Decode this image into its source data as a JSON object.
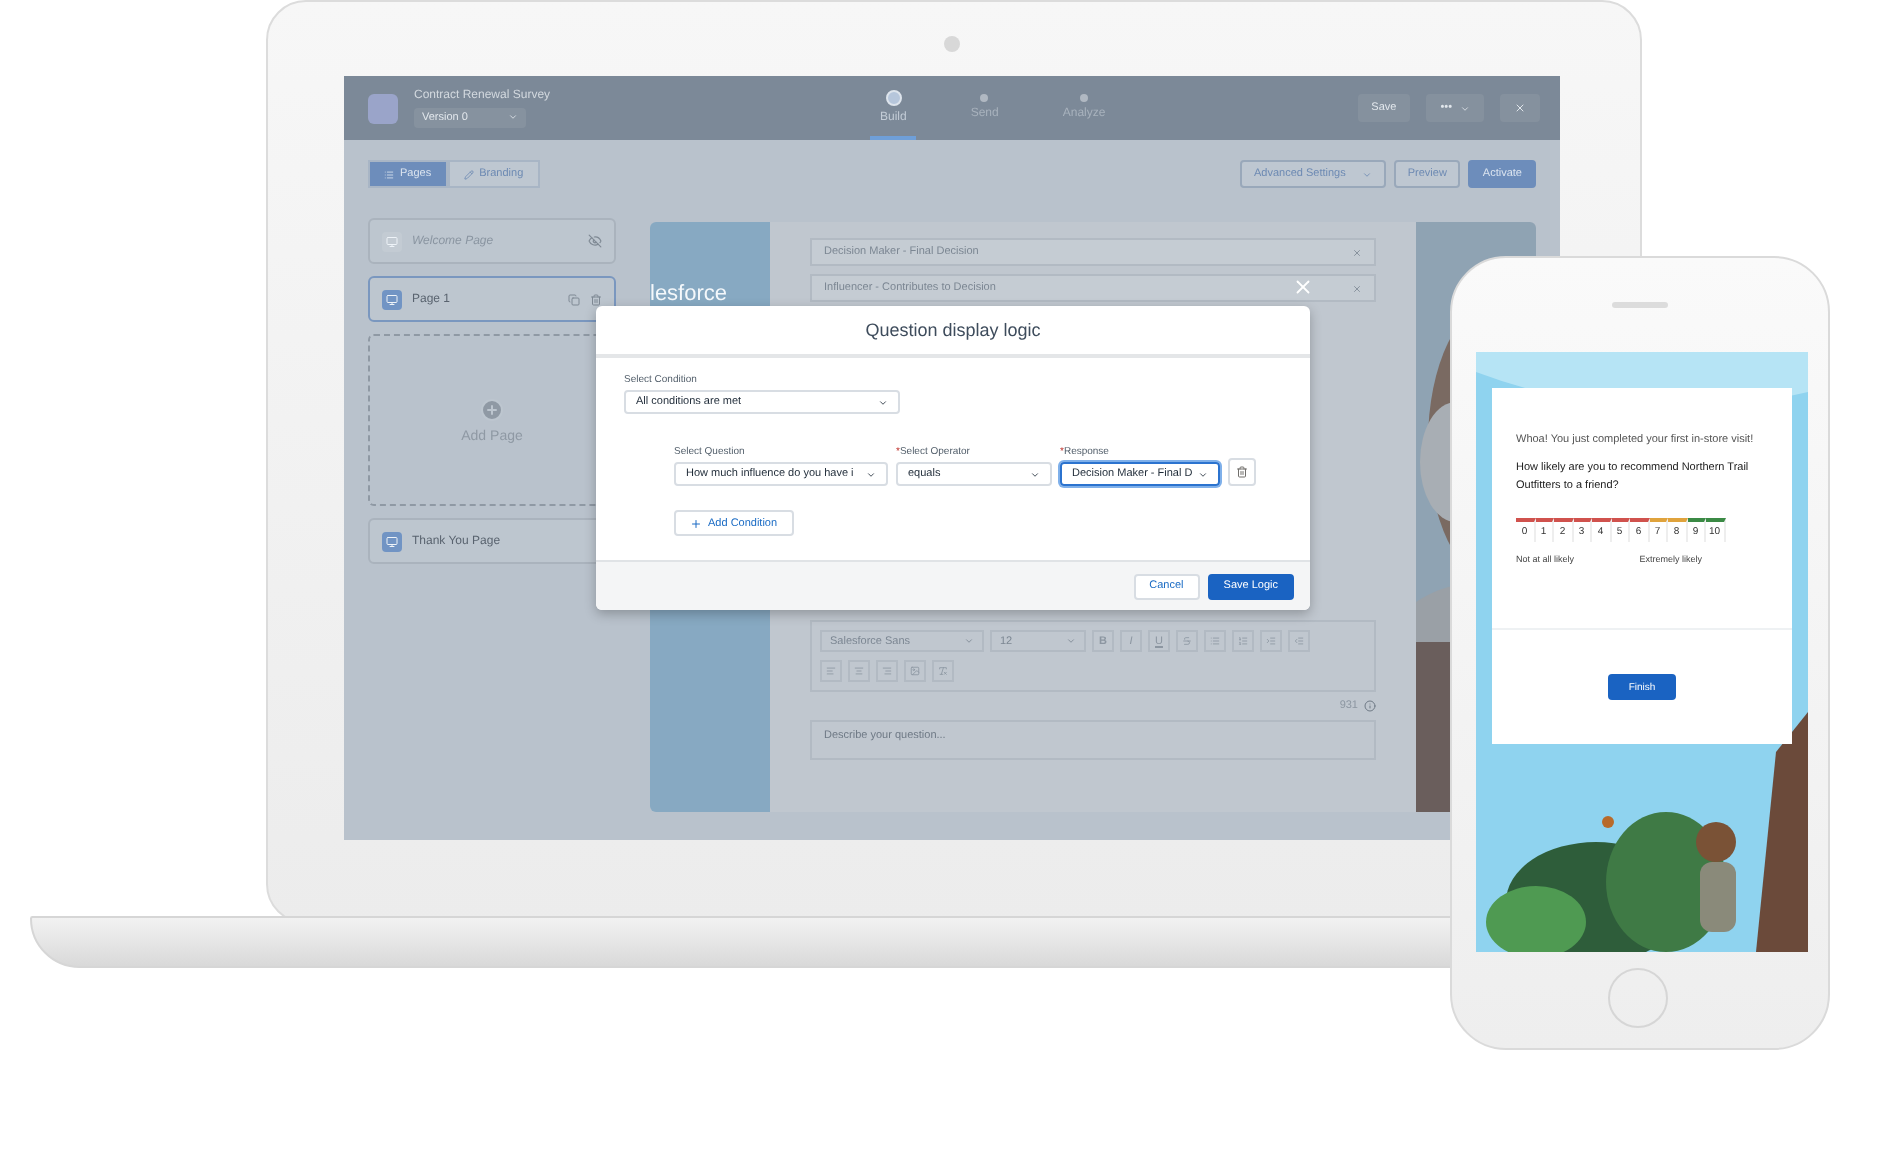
{
  "builder": {
    "header": {
      "title": "Contract Renewal Survey",
      "version": "Version 0",
      "steps": [
        {
          "label": "Build",
          "selected": true
        },
        {
          "label": "Send",
          "selected": false
        },
        {
          "label": "Analyze",
          "selected": false
        }
      ],
      "save": "Save",
      "more": "•••"
    },
    "toolbar": {
      "tabs": [
        {
          "label": "Pages",
          "selected": true
        },
        {
          "label": "Branding",
          "selected": false
        }
      ],
      "buttons": [
        {
          "label": "Advanced Settings",
          "kind": "split"
        },
        {
          "label": "Preview",
          "kind": "neutral"
        },
        {
          "label": "Activate",
          "kind": "brand"
        }
      ]
    },
    "pages": [
      {
        "label": "Welcome Page",
        "kind": "page",
        "hidden": true,
        "selected": false
      },
      {
        "label": "Page 1",
        "kind": "page",
        "hidden": false,
        "selected": true
      },
      {
        "label": "Add Page",
        "kind": "add",
        "selected": false
      },
      {
        "label": "Thank You Page",
        "kind": "page",
        "hidden": false,
        "selected": false
      }
    ],
    "canvas": {
      "brand_text": "lesforce",
      "answers": [
        "Decision Maker - Final Decision",
        "Influencer - Contributes to Decision"
      ],
      "font": "Salesforce Sans",
      "size": "12",
      "format_buttons": [
        "B",
        "I",
        "U"
      ],
      "char_count": "931",
      "description_placeholder": "Describe your question..."
    }
  },
  "modal": {
    "title": "Question display logic",
    "condition_label": "Select Condition",
    "condition_value": "All conditions are met",
    "fields": [
      {
        "label": "Select Question",
        "focused": false,
        "value": "How much influence do you have i"
      },
      {
        "label": "Select Operator",
        "required_mark": "*",
        "focused": false,
        "value": "equals"
      },
      {
        "label": "Response",
        "required_mark": "*",
        "focused": true,
        "value": "Decision Maker - Final D"
      }
    ],
    "add_condition": "Add Condition",
    "buttons": [
      {
        "label": "Cancel",
        "kind": "neutral"
      },
      {
        "label": "Save Logic",
        "kind": "brand"
      }
    ]
  },
  "phone": {
    "intro": "Whoa! You just completed your first in-store visit!",
    "question": "How likely are you to recommend Northern Trail Outfitters to a friend?",
    "scale": [
      {
        "label": "0",
        "color": "#d0524d"
      },
      {
        "label": "1",
        "color": "#d0524d"
      },
      {
        "label": "2",
        "color": "#d0524d"
      },
      {
        "label": "3",
        "color": "#d0524d"
      },
      {
        "label": "4",
        "color": "#d0524d"
      },
      {
        "label": "5",
        "color": "#d0524d"
      },
      {
        "label": "6",
        "color": "#d0524d"
      },
      {
        "label": "7",
        "color": "#e0a33c"
      },
      {
        "label": "8",
        "color": "#e0a33c"
      },
      {
        "label": "9",
        "color": "#3b8a45"
      },
      {
        "label": "10",
        "color": "#3b8a45"
      }
    ],
    "low_label": "Not at all likely",
    "high_label": "Extremely likely",
    "finish": "Finish"
  }
}
